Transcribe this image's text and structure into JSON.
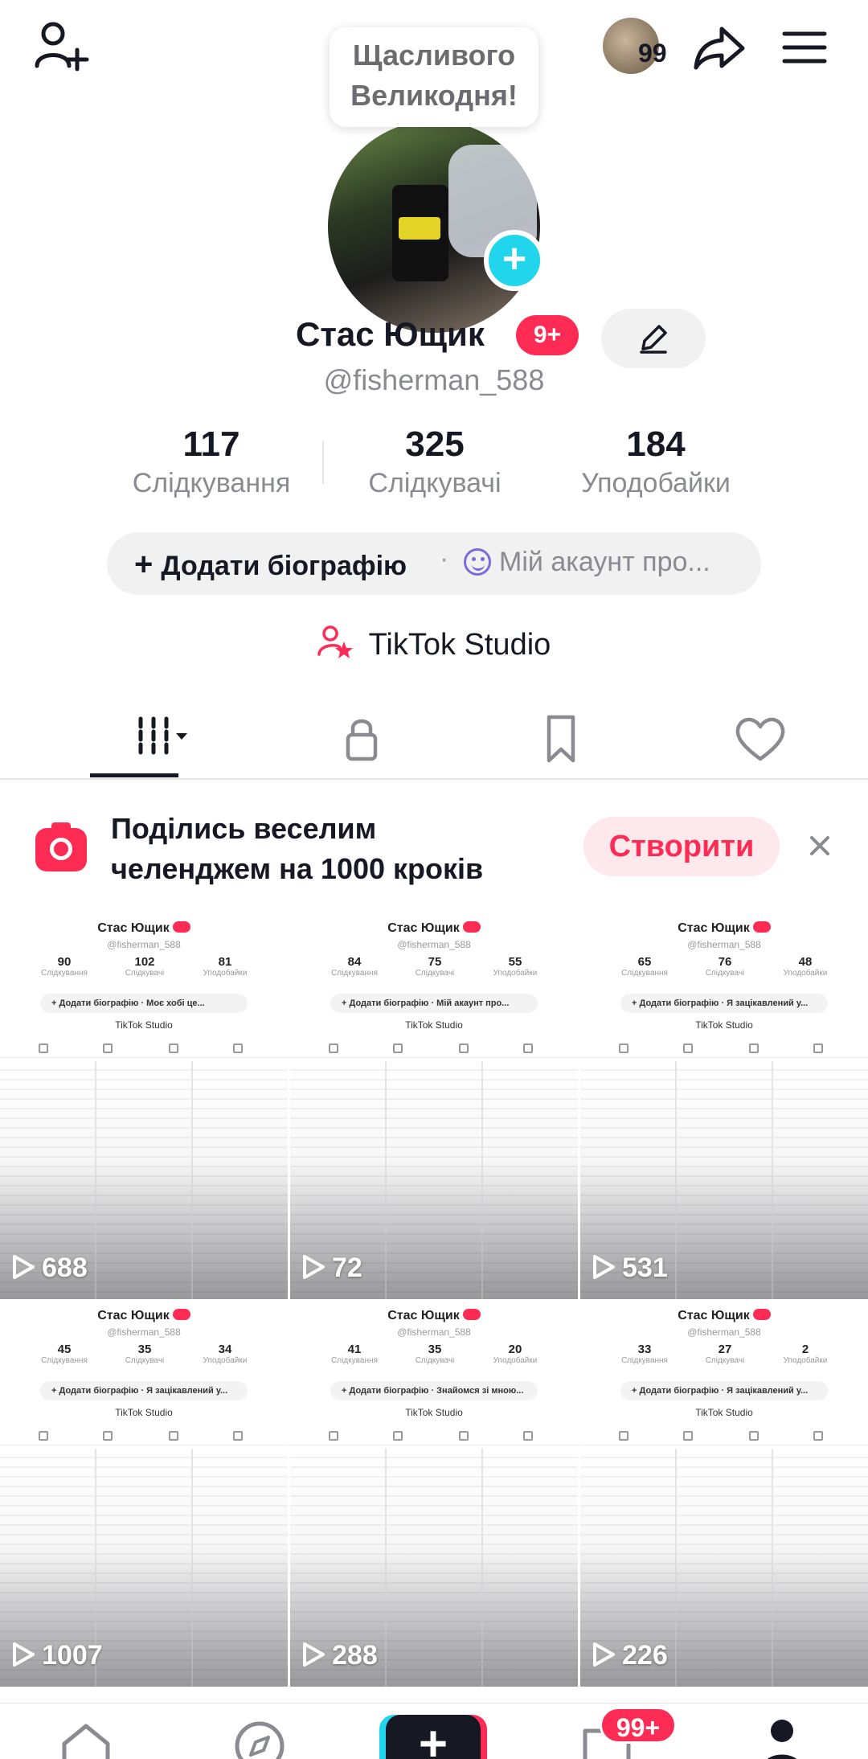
{
  "header": {
    "story_bubble": "Щасливого Великодня!",
    "friends_count": "99"
  },
  "profile": {
    "name": "Стас Ющик",
    "name_badge": "9+",
    "username": "@fisherman_588",
    "stats": [
      {
        "value": "117",
        "label": "Слідкування"
      },
      {
        "value": "325",
        "label": "Слідкувачі"
      },
      {
        "value": "184",
        "label": "Уподобайки"
      }
    ],
    "bio_add": "Додати біографію",
    "bio_separator": "·",
    "bio_status": "Мій акаунт про...",
    "studio": "TikTok Studio"
  },
  "banner": {
    "text_line1": "Поділись веселим",
    "text_line2": "челенджем на 1000 кроків",
    "create_label": "Створити"
  },
  "videos": [
    {
      "plays": "688",
      "mini_stats": [
        "90",
        "102",
        "81"
      ],
      "mini_bio": "+ Додати біографію · Моє хобі це..."
    },
    {
      "plays": "72",
      "mini_stats": [
        "84",
        "75",
        "55"
      ],
      "mini_bio": "+ Додати біографію · Мій акаунт про..."
    },
    {
      "plays": "531",
      "mini_stats": [
        "65",
        "76",
        "48"
      ],
      "mini_bio": "+ Додати біографію · Я зацікавлений у..."
    },
    {
      "plays": "1007",
      "mini_stats": [
        "45",
        "35",
        "34"
      ],
      "mini_bio": "+ Додати біографію · Я зацікавлений у..."
    },
    {
      "plays": "288",
      "mini_stats": [
        "41",
        "35",
        "20"
      ],
      "mini_bio": "+ Додати біографію · Знайомся зі мною..."
    },
    {
      "plays": "226",
      "mini_stats": [
        "33",
        "27",
        "2"
      ],
      "mini_bio": "+ Додати біографію · Я зацікавлений у..."
    }
  ],
  "mini": {
    "name": "Стас Ющик",
    "username": "@fisherman_588",
    "labels": [
      "Слідкування",
      "Слідкувачі",
      "Уподобайки"
    ],
    "studio": "TikTok Studio"
  },
  "bottom_nav": {
    "create_symbol": "+",
    "inbox_badge": "99+"
  },
  "colors": {
    "accent": "#fe2c55",
    "cyan": "#20d5ec",
    "text": "#161823",
    "muted": "#8a8b91"
  }
}
